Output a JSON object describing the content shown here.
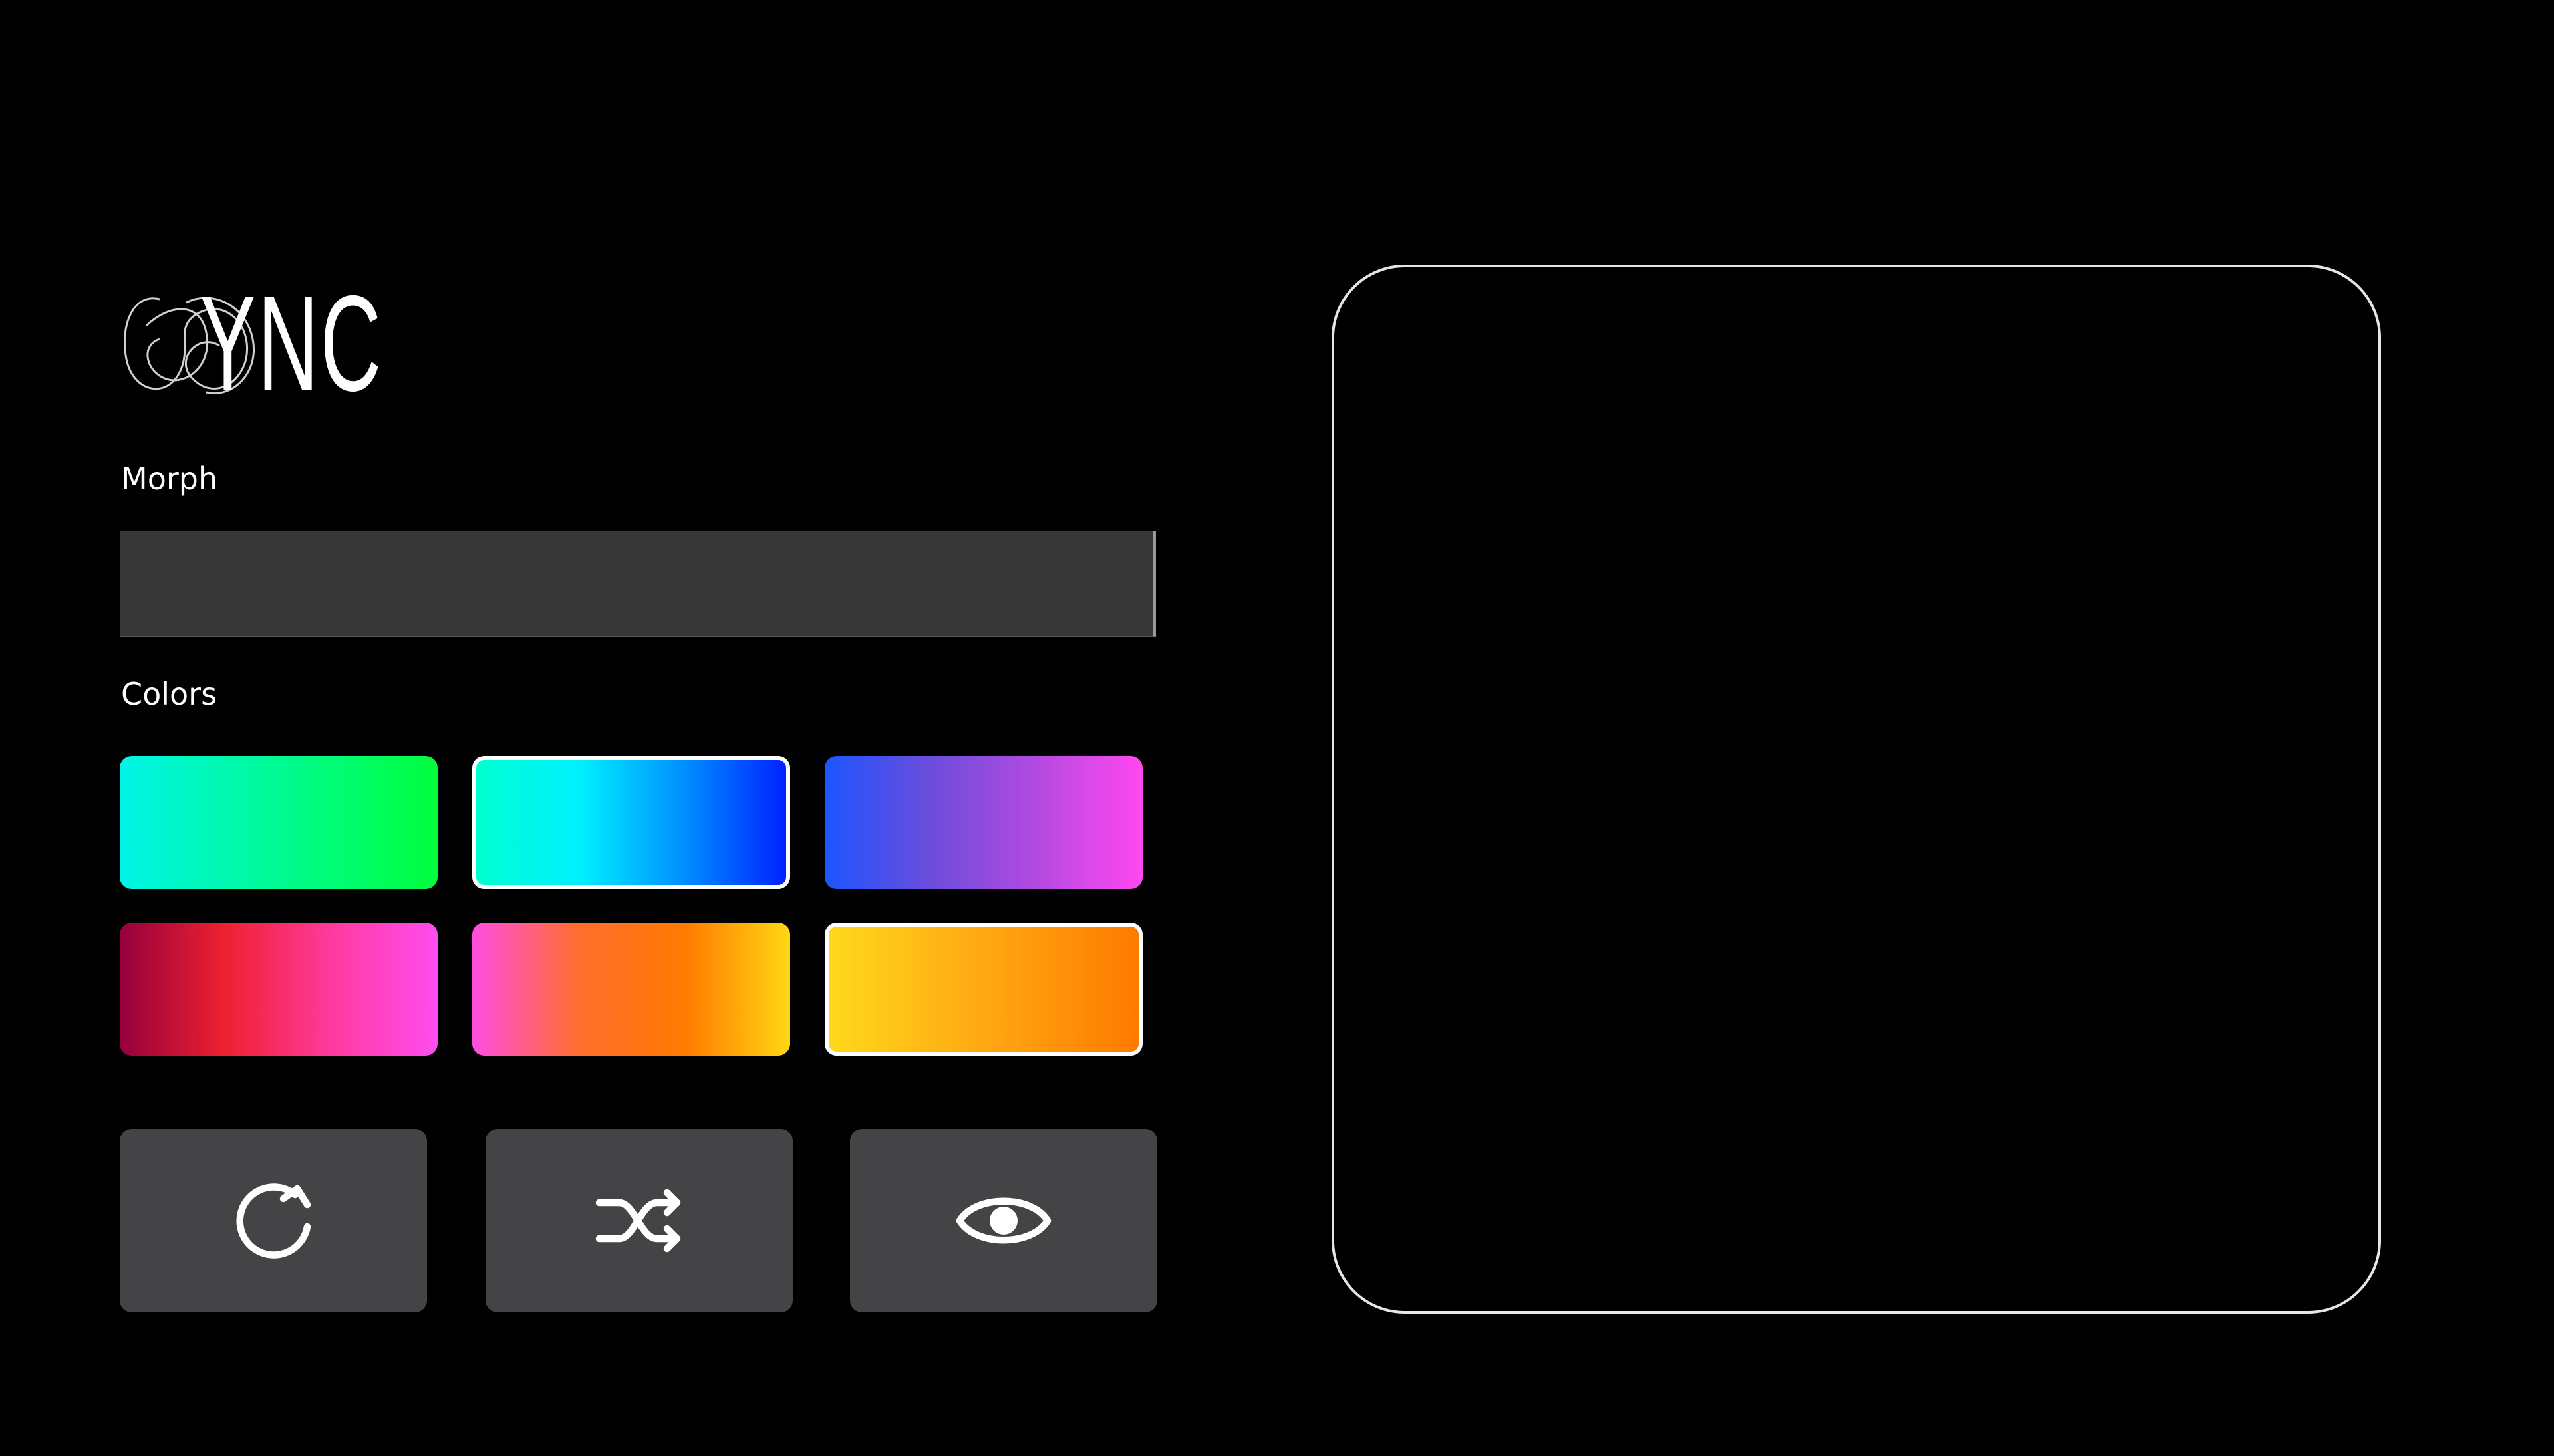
{
  "logo": {
    "text": "YNC"
  },
  "morph": {
    "label": "Morph"
  },
  "colors": {
    "label": "Colors",
    "swatches": [
      {
        "name": "cyan-green",
        "stops": [
          "#00f5e8",
          "#00ff3c"
        ],
        "selected": false
      },
      {
        "name": "cyan-blue",
        "stops": [
          "#00ffd0",
          "#00f0ff",
          "#0090ff",
          "#0022ff"
        ],
        "selected": true
      },
      {
        "name": "blue-purple-pink",
        "stops": [
          "#1e55ff",
          "#6b4ddb",
          "#b34ae0",
          "#ff48f0"
        ],
        "selected": false
      },
      {
        "name": "crimson-red-pink",
        "stops": [
          "#96003c",
          "#ee2130",
          "#ff3a9e",
          "#ff4df0"
        ],
        "selected": false
      },
      {
        "name": "pink-orange-yellow",
        "stops": [
          "#ff4ee0",
          "#ff6e2e",
          "#ff7a00",
          "#ffd714"
        ],
        "selected": false
      },
      {
        "name": "yellow-orange",
        "stops": [
          "#ffd81c",
          "#ffa812",
          "#ff7a00"
        ],
        "selected": true
      }
    ]
  },
  "actions": [
    {
      "name": "reset",
      "icon": "rotate-cw-icon"
    },
    {
      "name": "shuffle",
      "icon": "shuffle-icon"
    },
    {
      "name": "preview",
      "icon": "eye-icon"
    }
  ],
  "theme": {
    "background": "#000000",
    "panel": "#373737",
    "button": "#444446",
    "outline": "#e6e6e6",
    "text": "#ffffff"
  }
}
